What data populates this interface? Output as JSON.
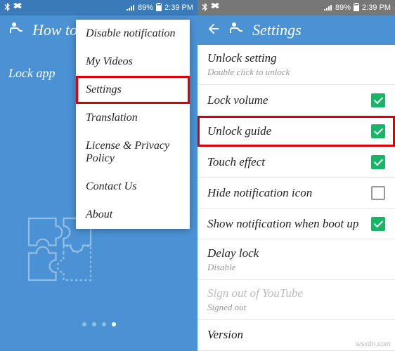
{
  "status": {
    "battery": "89%",
    "time": "2:39 PM"
  },
  "left": {
    "app_title": "How to use",
    "lock_app": "Lock app",
    "menu": [
      "Disable notification",
      "My Videos",
      "Settings",
      "Translation",
      "License & Privacy Policy",
      "Contact Us",
      "About"
    ],
    "highlighted_menu_index": 2
  },
  "right": {
    "app_title": "Settings",
    "items": [
      {
        "title": "Unlock setting",
        "sub": "Double click to unlock",
        "control": "none"
      },
      {
        "title": "Lock volume",
        "control": "checkbox",
        "checked": true
      },
      {
        "title": "Unlock guide",
        "control": "checkbox",
        "checked": true,
        "highlighted": true
      },
      {
        "title": "Touch effect",
        "control": "checkbox",
        "checked": true
      },
      {
        "title": "Hide notification icon",
        "control": "checkbox",
        "checked": false
      },
      {
        "title": "Show notification when boot up",
        "control": "checkbox",
        "checked": true
      },
      {
        "title": "Delay lock",
        "sub": "Disable",
        "control": "none"
      },
      {
        "title": "Sign out of YouTube",
        "sub": "Signed out",
        "control": "none",
        "disabled": true
      },
      {
        "title": "Version",
        "sub": "",
        "control": "none"
      }
    ]
  },
  "watermark": "wsxdn.com"
}
